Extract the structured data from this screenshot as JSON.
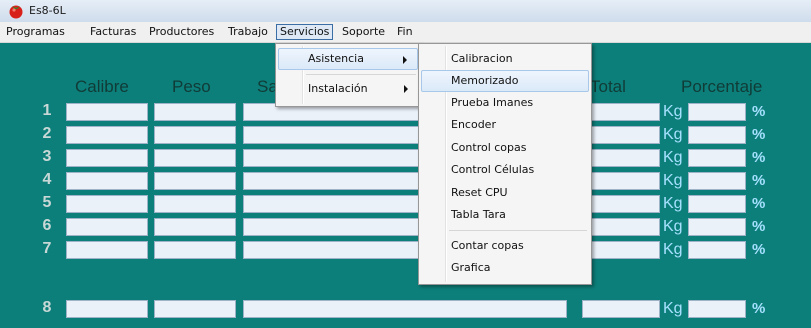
{
  "window": {
    "title": "Es8-6L"
  },
  "menubar": {
    "items": [
      "Programas",
      "Facturas",
      "Productores",
      "Trabajo",
      "Servicios",
      "Soporte",
      "Fin"
    ],
    "active": "Servicios"
  },
  "table": {
    "headers": {
      "calibre": "Calibre",
      "peso": "Peso",
      "partial": "Sa",
      "total": "Total",
      "porcentaje": "Porcentaje"
    },
    "rows": [
      {
        "num": "1",
        "unit": "Kg",
        "pct": "%"
      },
      {
        "num": "2",
        "unit": "Kg",
        "pct": "%"
      },
      {
        "num": "3",
        "unit": "Kg",
        "pct": "%"
      },
      {
        "num": "4",
        "unit": "Kg",
        "pct": "%"
      },
      {
        "num": "5",
        "unit": "Kg",
        "pct": "%"
      },
      {
        "num": "6",
        "unit": "Kg",
        "pct": "%"
      },
      {
        "num": "7",
        "unit": "Kg",
        "pct": "%"
      },
      {
        "num": "8",
        "unit": "Kg",
        "pct": "%"
      }
    ]
  },
  "servicios_menu": {
    "items": [
      "Asistencia",
      "Instalación"
    ]
  },
  "asistencia_submenu": {
    "items": [
      "Calibracion",
      "Memorizado",
      "Prueba Imanes",
      "Encoder",
      "Control copas",
      "Control Células",
      "Reset CPU",
      "Tabla Tara",
      "Contar copas",
      "Grafica"
    ],
    "hovered": "Memorizado"
  },
  "colors": {
    "background": "#0d7f7a",
    "field": "#eaf1f9",
    "unit_text": "#a6e1ff",
    "header_text": "#103b37"
  },
  "icons": {
    "app": "tomato-icon",
    "submenu_arrow": "chevron-right-icon"
  }
}
